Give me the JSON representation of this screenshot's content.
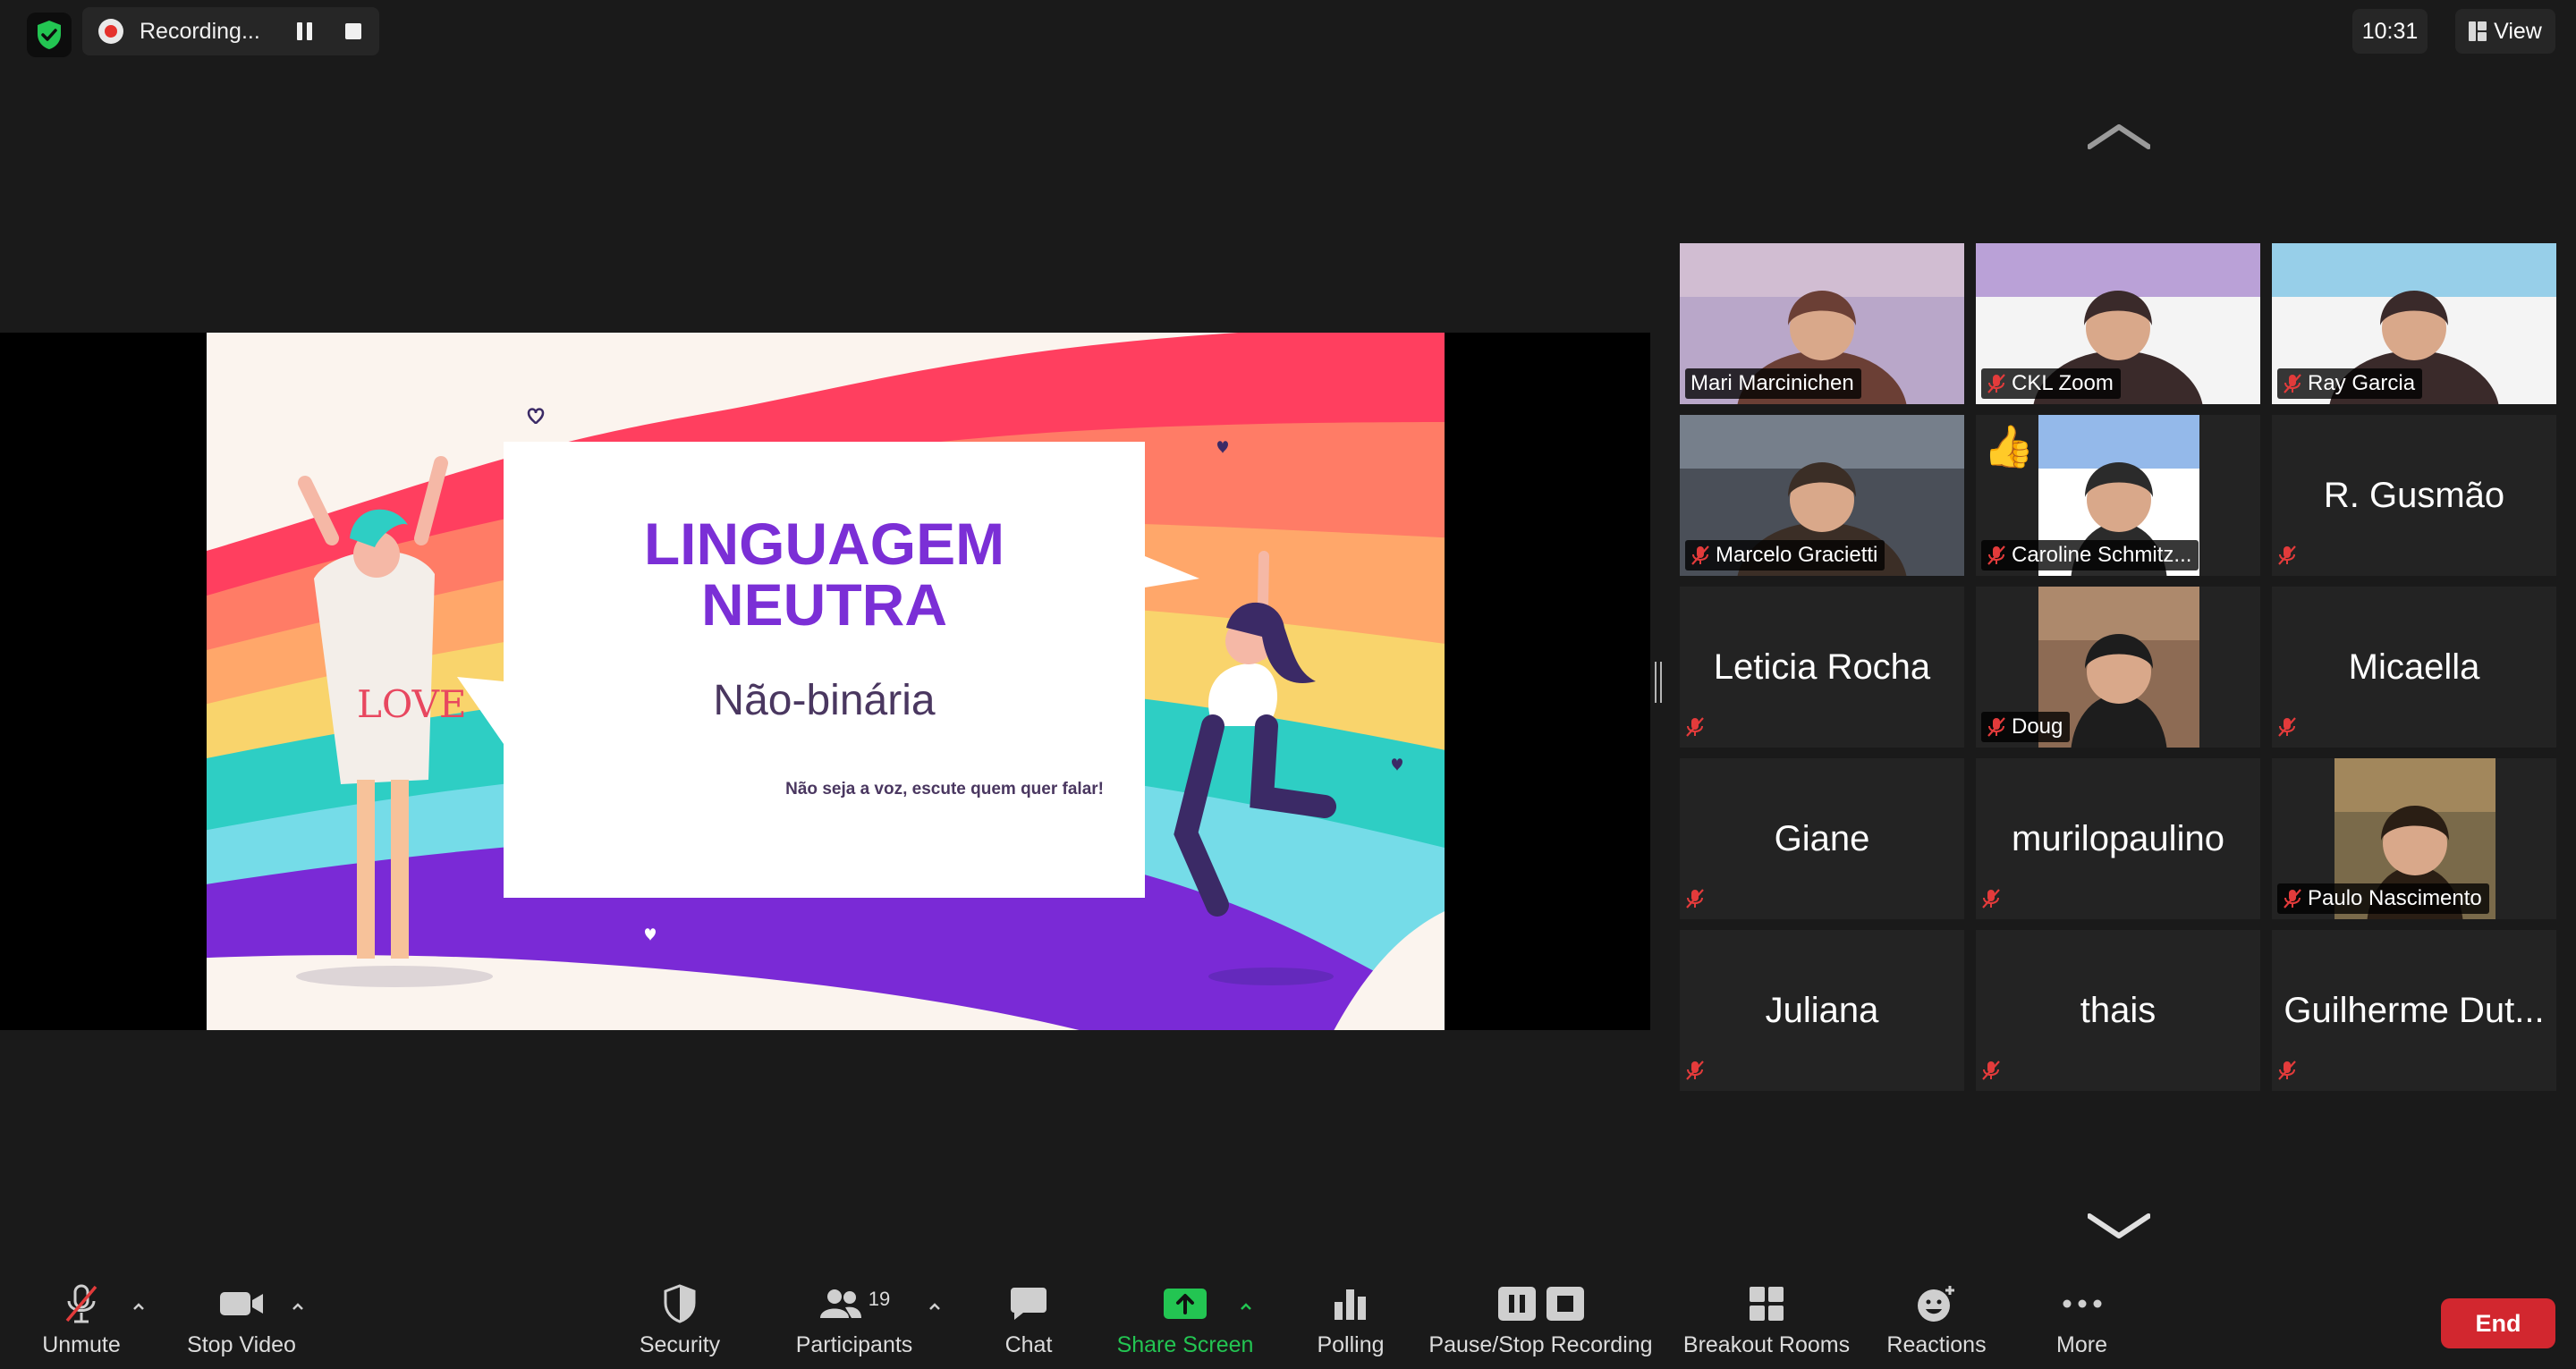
{
  "window": {
    "time": "10:31",
    "view_label": "View"
  },
  "recording": {
    "label": "Recording..."
  },
  "slide": {
    "title_line1": "LINGUAGEM",
    "title_line2": "NEUTRA",
    "subtitle": "Não-binária",
    "tagline": "Não seja a voz, escute quem quer falar!",
    "shirt_text": "LOVE"
  },
  "gallery": {
    "tiles": [
      {
        "name": "Mari Marcinichen",
        "video": true,
        "muted": false,
        "active": true
      },
      {
        "name": "CKL Zoom",
        "video": true,
        "muted": true
      },
      {
        "name": "Ray Garcia",
        "video": true,
        "muted": true
      },
      {
        "name": "Marcelo Gracietti",
        "video": true,
        "muted": true
      },
      {
        "name": "Caroline Schmitz...",
        "video": true,
        "muted": true,
        "reaction": "thumbs-up"
      },
      {
        "name": "R. Gusmão",
        "video": false,
        "muted": true
      },
      {
        "name": "Leticia Rocha",
        "video": false,
        "muted": true
      },
      {
        "name": "Doug",
        "video": true,
        "muted": true
      },
      {
        "name": "Micaella",
        "video": false,
        "muted": true
      },
      {
        "name": "Giane",
        "video": false,
        "muted": true
      },
      {
        "name": "murilopaulino",
        "video": false,
        "muted": true
      },
      {
        "name": "Paulo Nascimento",
        "video": true,
        "muted": true
      },
      {
        "name": "Juliana",
        "video": false,
        "muted": true
      },
      {
        "name": "thais",
        "video": false,
        "muted": true
      },
      {
        "name": "Guilherme Dut...",
        "video": false,
        "muted": true
      }
    ]
  },
  "toolbar": {
    "unmute": "Unmute",
    "stop_video": "Stop Video",
    "security": "Security",
    "participants": "Participants",
    "participants_count": "19",
    "chat": "Chat",
    "share_screen": "Share Screen",
    "polling": "Polling",
    "pause_stop_recording": "Pause/Stop Recording",
    "breakout_rooms": "Breakout Rooms",
    "reactions": "Reactions",
    "more": "More",
    "end": "End"
  },
  "colors": {
    "accent_green": "#23c552",
    "end_red": "#d2272f",
    "active_speaker": "#c6df7c",
    "slide_purple": "#7b2fd6"
  }
}
